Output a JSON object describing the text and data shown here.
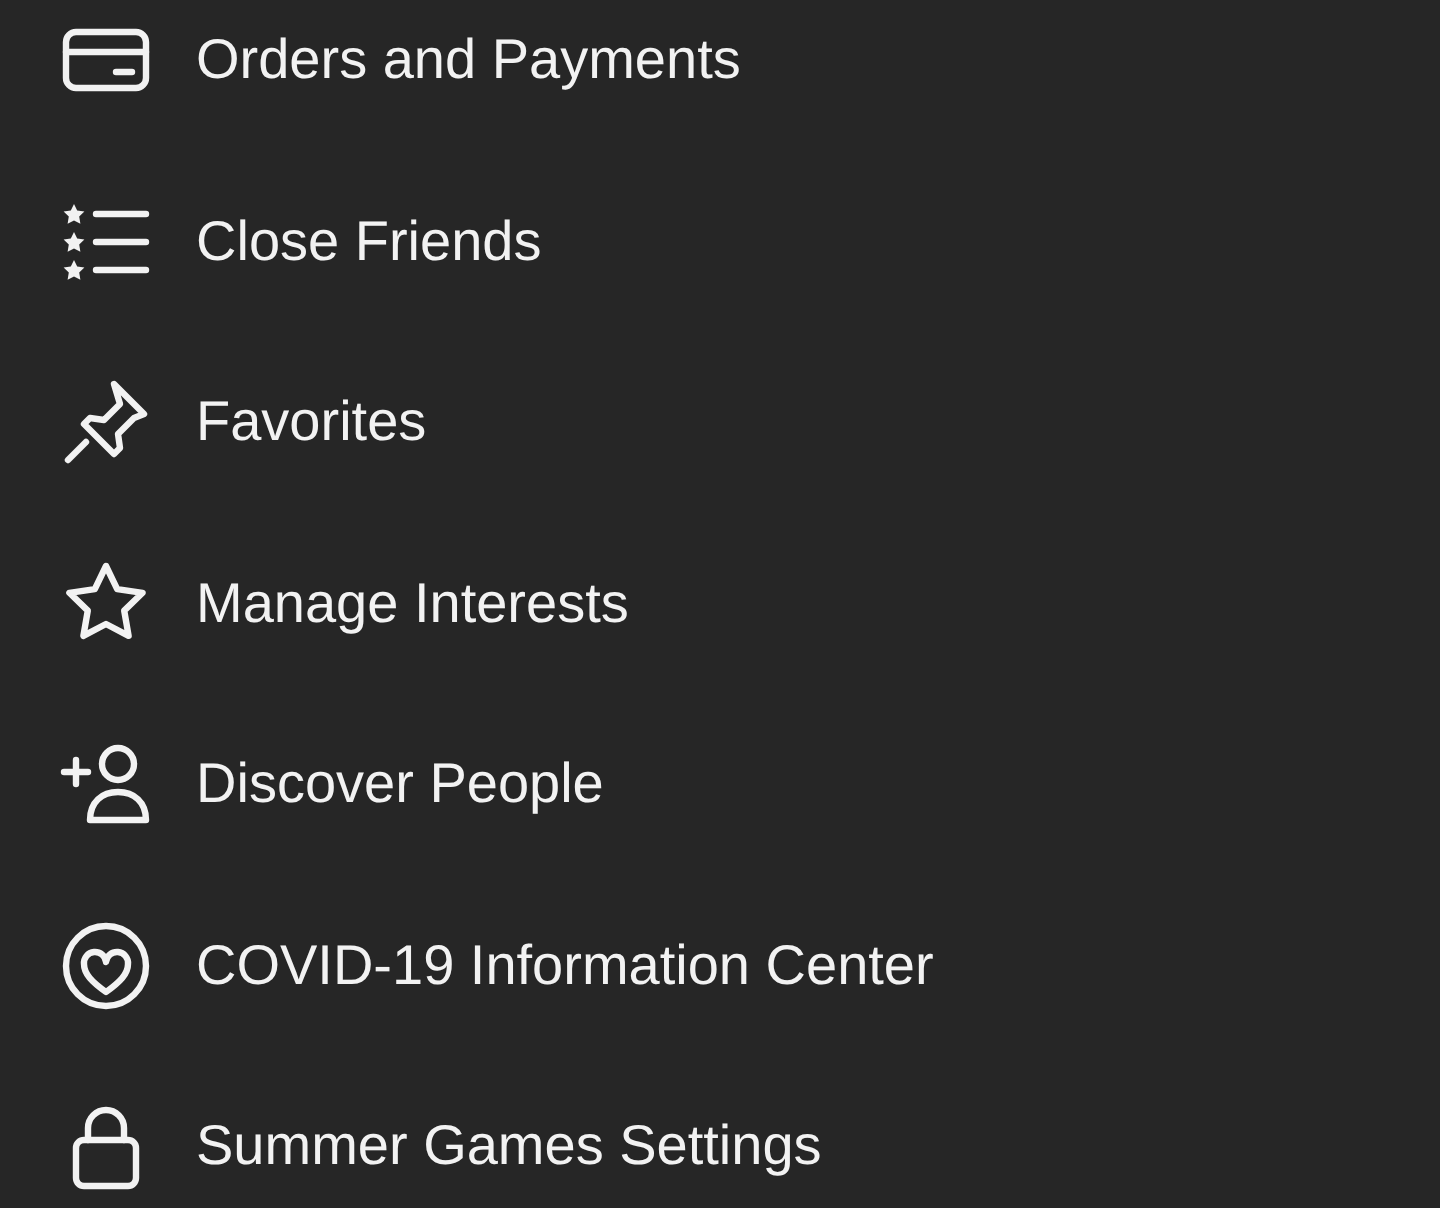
{
  "menu": {
    "items": [
      {
        "label": "Orders and Payments"
      },
      {
        "label": "Close Friends"
      },
      {
        "label": "Favorites"
      },
      {
        "label": "Manage Interests"
      },
      {
        "label": "Discover People"
      },
      {
        "label": "COVID-19 Information Center"
      },
      {
        "label": "Summer Games Settings"
      }
    ]
  }
}
